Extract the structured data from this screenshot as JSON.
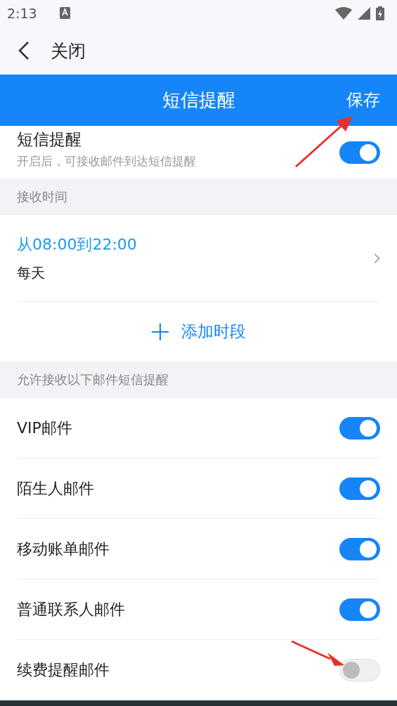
{
  "status_bar": {
    "time": "2:13"
  },
  "top_bar": {
    "back_label": "关闭"
  },
  "title_bar": {
    "title": "短信提醒",
    "action": "保存"
  },
  "master": {
    "title": "短信提醒",
    "subtitle": "开启后，可接收邮件到达短信提醒",
    "on": true
  },
  "receive_time": {
    "header": "接收时间",
    "periods": [
      {
        "range": "从08:00到22:00",
        "repeat": "每天"
      }
    ],
    "add_label": "添加时段"
  },
  "mail_types": {
    "header": "允许接收以下邮件短信提醒",
    "items": [
      {
        "label": "VIP邮件",
        "on": true
      },
      {
        "label": "陌生人邮件",
        "on": true
      },
      {
        "label": "移动账单邮件",
        "on": true
      },
      {
        "label": "普通联系人邮件",
        "on": true
      },
      {
        "label": "续费提醒邮件",
        "on": false
      }
    ]
  }
}
